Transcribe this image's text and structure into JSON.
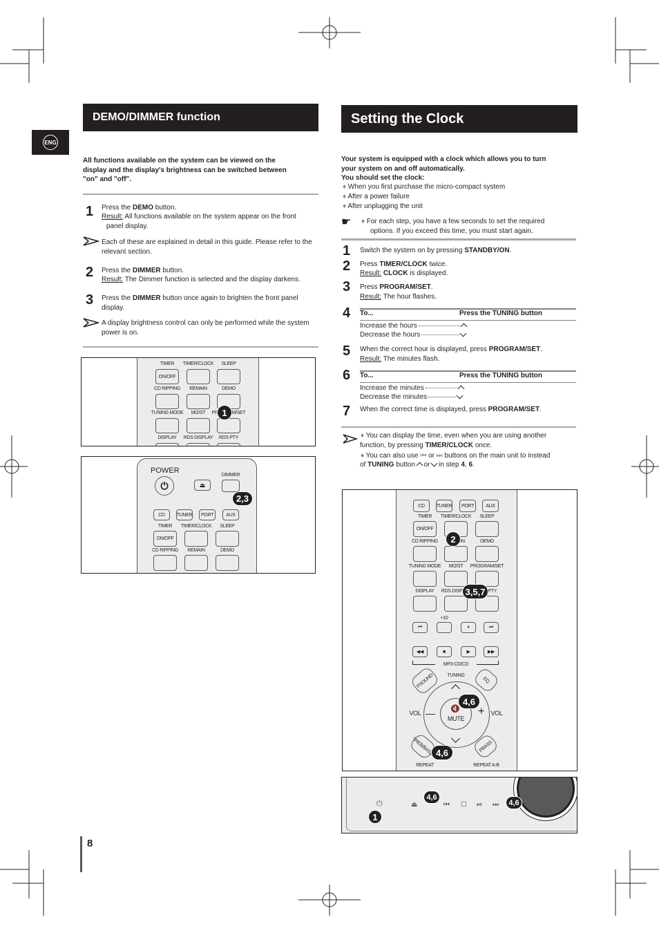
{
  "left": {
    "title": "DEMO/DIMMER function",
    "lang_tab": "ENG",
    "intro": [
      "All functions available on the system can be viewed on the",
      "display and the display's  brightness can be switched between",
      "\"on\" and \"off\"."
    ],
    "steps": [
      {
        "n": "1",
        "pre": "Press the ",
        "bold": "DEMO",
        "post": " button.",
        "result_label": "Result:",
        "result": " All functions available on the system appear on the front",
        "result2": "panel display."
      },
      {
        "note": [
          "Each of these are explained in detail in this guide. Please refer to the",
          "relevant section."
        ]
      },
      {
        "n": "2",
        "pre": "Press the ",
        "bold": "DIMMER",
        "post": " button.",
        "result_label": "Result:",
        "result": " The Dimmer function is selected and the display darkens."
      },
      {
        "n": "3",
        "pre": "Press the ",
        "bold": "DIMMER",
        "post": " button once again to brighten the front panel",
        "line2": "display."
      },
      {
        "note": [
          "A display brightness control can only be performed while the system",
          "power is on."
        ]
      }
    ],
    "remote_top": {
      "rows": [
        {
          "labels": [
            "TIMER",
            "TIMER/CLOCK",
            "SLEEP"
          ],
          "inside": [
            "ON/OFF",
            "",
            ""
          ]
        },
        {
          "labels": [
            "CD RIPPING",
            "REMAIN",
            "DEMO"
          ],
          "inside": [
            "",
            "",
            ""
          ]
        },
        {
          "labels": [
            "TUNING MODE",
            "MO/ST",
            "PROGRAM/SET"
          ],
          "inside": [
            "",
            "",
            ""
          ]
        },
        {
          "labels": [
            "DISPLAY",
            "RDS DISPLAY",
            "RDS PTY"
          ],
          "inside": [
            "",
            "",
            ""
          ]
        }
      ],
      "callout": "1"
    },
    "remote_bottom": {
      "power": "POWER",
      "dimmer": "DIMMER",
      "sources": [
        "CD",
        "TUNER",
        "PORT",
        "AUX"
      ],
      "rows": [
        {
          "labels": [
            "TIMER",
            "TIMER/CLOCK",
            "SLEEP"
          ],
          "inside": [
            "ON/OFF",
            "",
            ""
          ]
        },
        {
          "labels": [
            "CD RIPPING",
            "REMAIN",
            "DEMO"
          ],
          "inside": [
            "",
            "",
            ""
          ]
        }
      ],
      "callout": "2,3"
    }
  },
  "right": {
    "title": "Setting the Clock",
    "intro": [
      "Your system is equipped with a clock which allows you to turn",
      "your system on and off automatically.",
      "You should set the clock:"
    ],
    "bullets": [
      "When you first purchase the micro-compact system",
      "After a power failure",
      "After unplugging the unit"
    ],
    "tip": [
      "For each step, you have a few seconds to set the required",
      "options. If you exceed this time, you must start again."
    ],
    "step1": {
      "n": "1",
      "pre": "Switch the system on by pressing ",
      "bold": "STANDBY/ON",
      "post": "."
    },
    "step2": {
      "n": "2",
      "pre": "Press ",
      "bold": "TIMER/CLOCK",
      "post": " twice.",
      "result_label": "Result:",
      "result_bold": "CLOCK",
      "result": " is displayed."
    },
    "step3": {
      "n": "3",
      "pre": "Press ",
      "bold": "PROGRAM/SET",
      "post": ".",
      "result_label": "Result:",
      "result": " The hour flashes."
    },
    "step4": {
      "n": "4",
      "col1": "To...",
      "col2": "Press the TUNING button",
      "rows": [
        "Increase the hours",
        "Decrease the hours"
      ]
    },
    "step5": {
      "n": "5",
      "pre": "When the correct hour is displayed, press ",
      "bold": "PROGRAM/SET",
      "post": ".",
      "result_label": "Result:",
      "result": " The minutes flash."
    },
    "step6": {
      "n": "6",
      "col1": "To...",
      "col2": "Press the TUNING button",
      "rows": [
        "Increase the minutes",
        "Decrease the minutes"
      ]
    },
    "step7": {
      "n": "7",
      "pre": "When the correct time is displayed, press ",
      "bold": "PROGRAM/SET",
      "post": "."
    },
    "notes": {
      "a1": "You can display the time, even when you are using another",
      "a2_pre": "function, by pressing ",
      "a2_bold": "TIMER/CLOCK",
      "a2_post": " once.",
      "b1_pre": "You can also use ",
      "b1_or": " or ",
      "b1_post": " buttons on the main unit to instead",
      "b2_pre": "of ",
      "b2_bold": "TUNING",
      "b2_mid": " button ",
      "b2_or": " or ",
      "b2_post": " in step ",
      "b2_s1": "4",
      "b2_comma": ", ",
      "b2_s2": "6",
      "b2_end": "."
    },
    "remote": {
      "sources": [
        "CD",
        "TUNER",
        "PORT",
        "AUX"
      ],
      "rows": [
        {
          "labels": [
            "TIMER",
            "TIMER/CLOCK",
            "SLEEP"
          ],
          "inside": [
            "ON/OFF",
            "",
            ""
          ]
        },
        {
          "labels": [
            "CD RIPPING",
            "REMAIN",
            "DEMO"
          ],
          "inside": [
            "",
            "",
            ""
          ]
        },
        {
          "labels": [
            "TUNING MODE",
            "MO/ST",
            "PROGRAM/SET"
          ],
          "inside": [
            "",
            "",
            ""
          ]
        },
        {
          "labels": [
            "DISPLAY",
            "RDS DISPLAY",
            "RDS PTY"
          ],
          "inside": [
            "",
            "",
            ""
          ]
        }
      ],
      "plus10": "+10",
      "transport1": [
        "⏮",
        "",
        "⏸",
        "⏭"
      ],
      "transport2": [
        "◀◀",
        "■",
        "▶",
        "▶▶"
      ],
      "mp3": "MP3-CD/CD",
      "tuning": "TUNING",
      "psound": "PSOUND",
      "eq": "EQ",
      "vol": "VOL",
      "mute": "MUTE",
      "trebbass": "TREB/BASS",
      "pbass": "PBASS",
      "repeat": "REPEAT",
      "repeat_ab": "REPEAT A-B",
      "callouts": [
        "2",
        "3,5,7",
        "4,6",
        "4,6"
      ]
    },
    "front_panel": {
      "callouts": [
        "1",
        "4,6",
        "4,6"
      ]
    }
  },
  "page_number": "8"
}
